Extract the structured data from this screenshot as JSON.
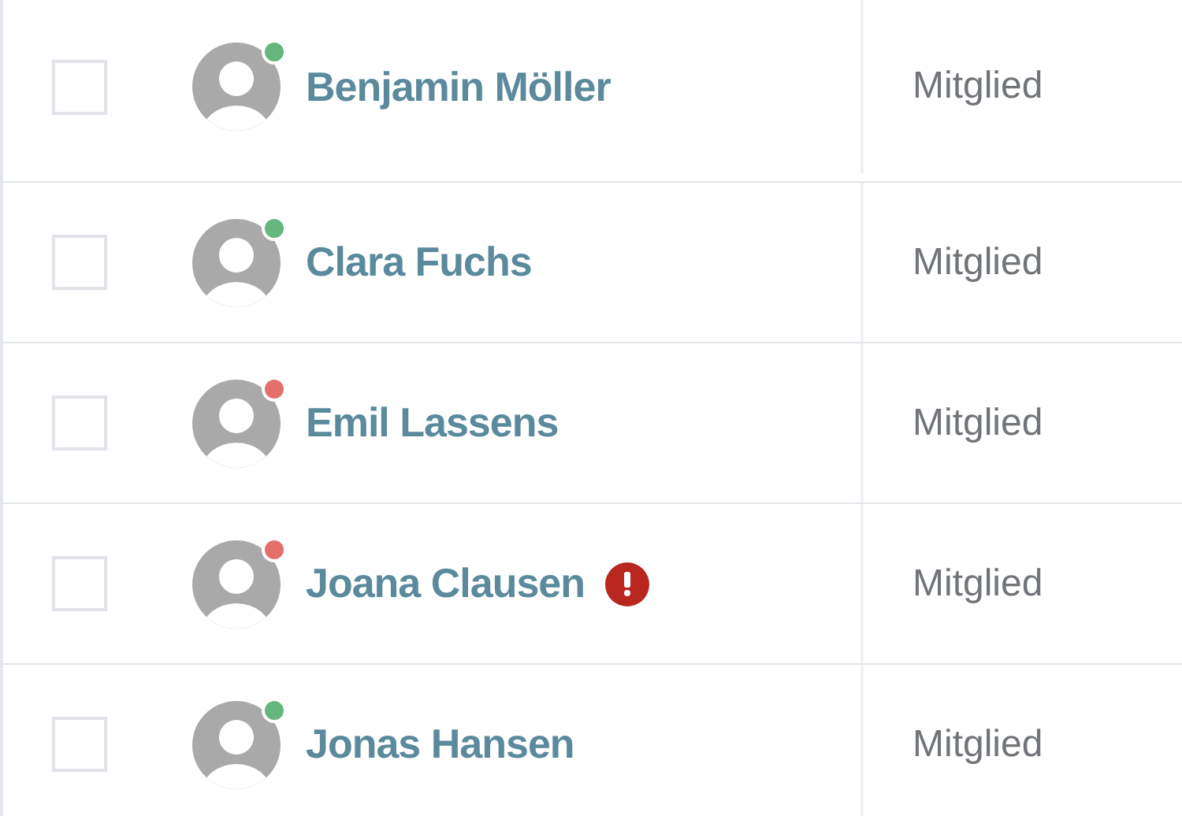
{
  "members": [
    {
      "name": "Benjamin Möller",
      "role": "Mitglied",
      "checked": false,
      "color": "#66b77d",
      "alert": false
    },
    {
      "name": "Clara Fuchs",
      "role": "Mitglied",
      "checked": false,
      "color": "#66b77d",
      "alert": false
    },
    {
      "name": "Emil Lassens",
      "role": "Mitglied",
      "checked": false,
      "color": "#e5706b",
      "alert": false
    },
    {
      "name": "Joana Clausen",
      "role": "Mitglied",
      "checked": false,
      "color": "#e5706b",
      "alert": true
    },
    {
      "name": "Jonas Hansen",
      "role": "Mitglied",
      "checked": false,
      "color": "#66b77d",
      "alert": false
    }
  ]
}
